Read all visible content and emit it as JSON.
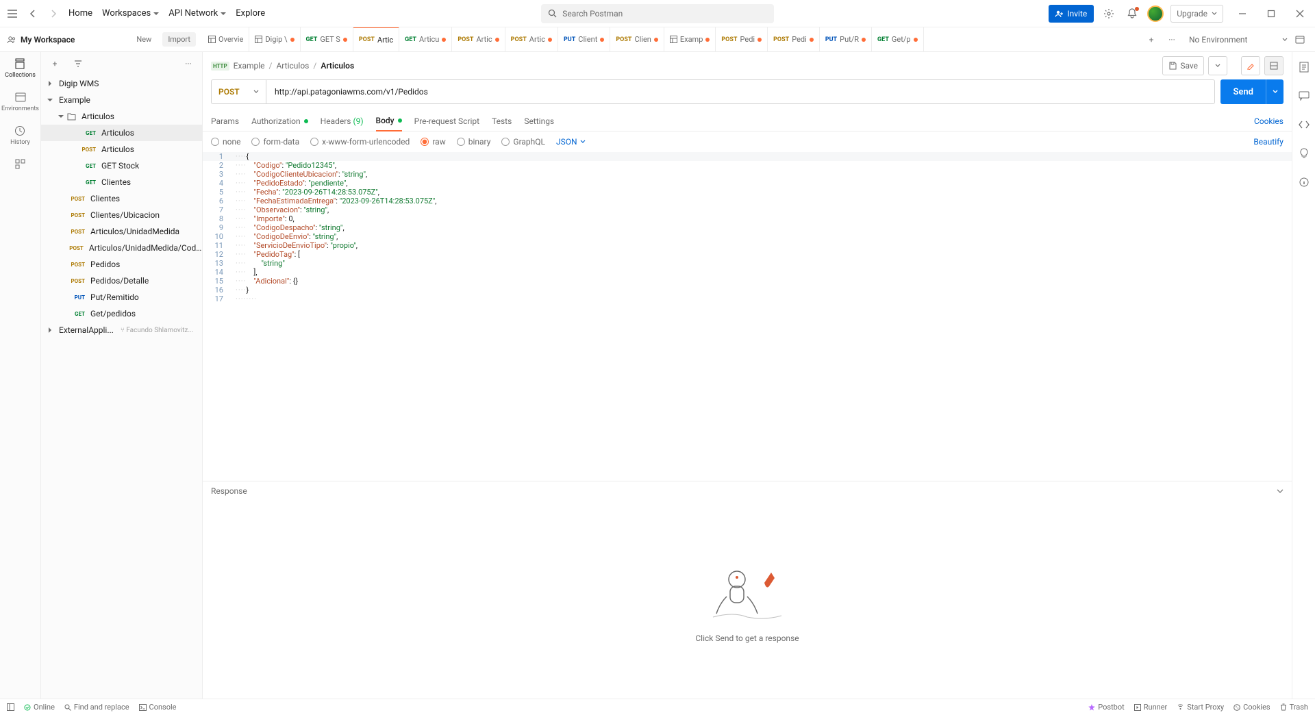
{
  "topnav": {
    "home": "Home",
    "workspaces": "Workspaces",
    "api_network": "API Network",
    "explore": "Explore",
    "search_placeholder": "Search Postman",
    "invite": "Invite",
    "upgrade": "Upgrade"
  },
  "workspace": {
    "name": "My Workspace",
    "new": "New",
    "import": "Import",
    "no_env": "No Environment"
  },
  "tabs": [
    {
      "icon": "overview",
      "label": "Overvie",
      "dirty": false
    },
    {
      "icon": "overview",
      "label": "Digip \\",
      "dirty": true
    },
    {
      "method": "GET",
      "label": "GET S",
      "dirty": true
    },
    {
      "method": "POST",
      "label": "Artic",
      "dirty": false,
      "active": true
    },
    {
      "method": "GET",
      "label": "Articu",
      "dirty": true
    },
    {
      "method": "POST",
      "label": "Artic",
      "dirty": true
    },
    {
      "method": "POST",
      "label": "Artic",
      "dirty": true
    },
    {
      "method": "PUT",
      "label": "Client",
      "dirty": true
    },
    {
      "method": "POST",
      "label": "Clien",
      "dirty": true
    },
    {
      "icon": "overview",
      "label": "Examp",
      "dirty": true
    },
    {
      "method": "POST",
      "label": "Pedi",
      "dirty": true
    },
    {
      "method": "POST",
      "label": "Pedi",
      "dirty": true
    },
    {
      "method": "PUT",
      "label": "Put/R",
      "dirty": true
    },
    {
      "method": "GET",
      "label": "Get/p",
      "dirty": true
    }
  ],
  "rail": {
    "collections": "Collections",
    "environments": "Environments",
    "history": "History"
  },
  "tree": [
    {
      "type": "folder",
      "level": 0,
      "caret": "closed",
      "label": "Digip WMS"
    },
    {
      "type": "folder",
      "level": 0,
      "caret": "open",
      "label": "Example"
    },
    {
      "type": "folder",
      "level": 1,
      "caret": "open",
      "label": "Articulos",
      "icon": "folder"
    },
    {
      "type": "req",
      "level": 2,
      "method": "GET",
      "label": "Articulos",
      "selected": true
    },
    {
      "type": "req",
      "level": 2,
      "method": "POST",
      "label": "Articulos"
    },
    {
      "type": "req",
      "level": 2,
      "method": "GET",
      "label": "GET Stock"
    },
    {
      "type": "req",
      "level": 2,
      "method": "GET",
      "label": "Clientes"
    },
    {
      "type": "req",
      "level": 1,
      "method": "POST",
      "label": "Clientes"
    },
    {
      "type": "req",
      "level": 1,
      "method": "POST",
      "label": "Clientes/Ubicacion"
    },
    {
      "type": "req",
      "level": 1,
      "method": "POST",
      "label": "Articulos/UnidadMedida"
    },
    {
      "type": "req",
      "level": 1,
      "method": "POST",
      "label": "Articulos/UnidadMedida/Codig..."
    },
    {
      "type": "req",
      "level": 1,
      "method": "POST",
      "label": "Pedidos"
    },
    {
      "type": "req",
      "level": 1,
      "method": "POST",
      "label": "Pedidos/Detalle"
    },
    {
      "type": "req",
      "level": 1,
      "method": "PUT",
      "label": "Put/Remitido"
    },
    {
      "type": "req",
      "level": 1,
      "method": "GET",
      "label": "Get/pedidos"
    },
    {
      "type": "folder",
      "level": 0,
      "caret": "closed",
      "label": "ExternalAppli...",
      "fork": "Facundo Shlamovitz..."
    }
  ],
  "breadcrumb": {
    "badge": "HTTP",
    "p1": "Example",
    "p2": "Articulos",
    "p3": "Articulos",
    "save": "Save"
  },
  "request": {
    "method": "POST",
    "url": "http://api.patagoniawms.com/v1/Pedidos",
    "send": "Send"
  },
  "req_tabs": {
    "params": "Params",
    "auth": "Authorization",
    "headers": "Headers",
    "headers_count": "(9)",
    "body": "Body",
    "pre": "Pre-request Script",
    "tests": "Tests",
    "settings": "Settings",
    "cookies": "Cookies"
  },
  "body_types": {
    "none": "none",
    "formdata": "form-data",
    "urlenc": "x-www-form-urlencoded",
    "raw": "raw",
    "binary": "binary",
    "graphql": "GraphQL",
    "json": "JSON",
    "beautify": "Beautify"
  },
  "editor_lines": [
    {
      "n": 1,
      "html": "<span class='tok-p'>{</span>"
    },
    {
      "n": 2,
      "html": "    <span class='tok-k'>\"Codigo\"</span><span class='tok-p'>: </span><span class='tok-s'>\"Pedido12345\"</span><span class='tok-p'>,</span>"
    },
    {
      "n": 3,
      "html": "    <span class='tok-k'>\"CodigoClienteUbicacion\"</span><span class='tok-p'>: </span><span class='tok-s'>\"string\"</span><span class='tok-p'>,</span>"
    },
    {
      "n": 4,
      "html": "    <span class='tok-k'>\"PedidoEstado\"</span><span class='tok-p'>: </span><span class='tok-s'>\"pendiente\"</span><span class='tok-p'>,</span>"
    },
    {
      "n": 5,
      "html": "    <span class='tok-k'>\"Fecha\"</span><span class='tok-p'>: </span><span class='tok-s'>\"2023-09-26T14:28:53.075Z\"</span><span class='tok-p'>,</span>"
    },
    {
      "n": 6,
      "html": "    <span class='tok-k'>\"FechaEstimadaEntrega\"</span><span class='tok-p'>: </span><span class='tok-s'>\"2023-09-26T14:28:53.075Z\"</span><span class='tok-p'>,</span>"
    },
    {
      "n": 7,
      "html": "    <span class='tok-k'>\"Observacion\"</span><span class='tok-p'>: </span><span class='tok-s'>\"string\"</span><span class='tok-p'>,</span>"
    },
    {
      "n": 8,
      "html": "    <span class='tok-k'>\"Importe\"</span><span class='tok-p'>: </span><span class='tok-n'>0</span><span class='tok-p'>,</span>"
    },
    {
      "n": 9,
      "html": "    <span class='tok-k'>\"CodigoDespacho\"</span><span class='tok-p'>: </span><span class='tok-s'>\"string\"</span><span class='tok-p'>,</span>"
    },
    {
      "n": 10,
      "html": "    <span class='tok-k'>\"CodigoDeEnvio\"</span><span class='tok-p'>: </span><span class='tok-s'>\"string\"</span><span class='tok-p'>,</span>"
    },
    {
      "n": 11,
      "html": "    <span class='tok-k'>\"ServicioDeEnvioTipo\"</span><span class='tok-p'>: </span><span class='tok-s'>\"propio\"</span><span class='tok-p'>,</span>"
    },
    {
      "n": 12,
      "html": "    <span class='tok-k'>\"PedidoTag\"</span><span class='tok-p'>: [</span>"
    },
    {
      "n": 13,
      "html": "        <span class='tok-s'>\"string\"</span>"
    },
    {
      "n": 14,
      "html": "    <span class='tok-p'>],</span>"
    },
    {
      "n": 15,
      "html": "    <span class='tok-k'>\"Adicional\"</span><span class='tok-p'>: {}</span>"
    },
    {
      "n": 16,
      "html": "<span class='tok-p'>}</span>"
    },
    {
      "n": 17,
      "html": ""
    }
  ],
  "response": {
    "header": "Response",
    "empty": "Click Send to get a response"
  },
  "status": {
    "online": "Online",
    "find": "Find and replace",
    "console": "Console",
    "postbot": "Postbot",
    "runner": "Runner",
    "proxy": "Start Proxy",
    "cookies": "Cookies",
    "trash": "Trash"
  }
}
